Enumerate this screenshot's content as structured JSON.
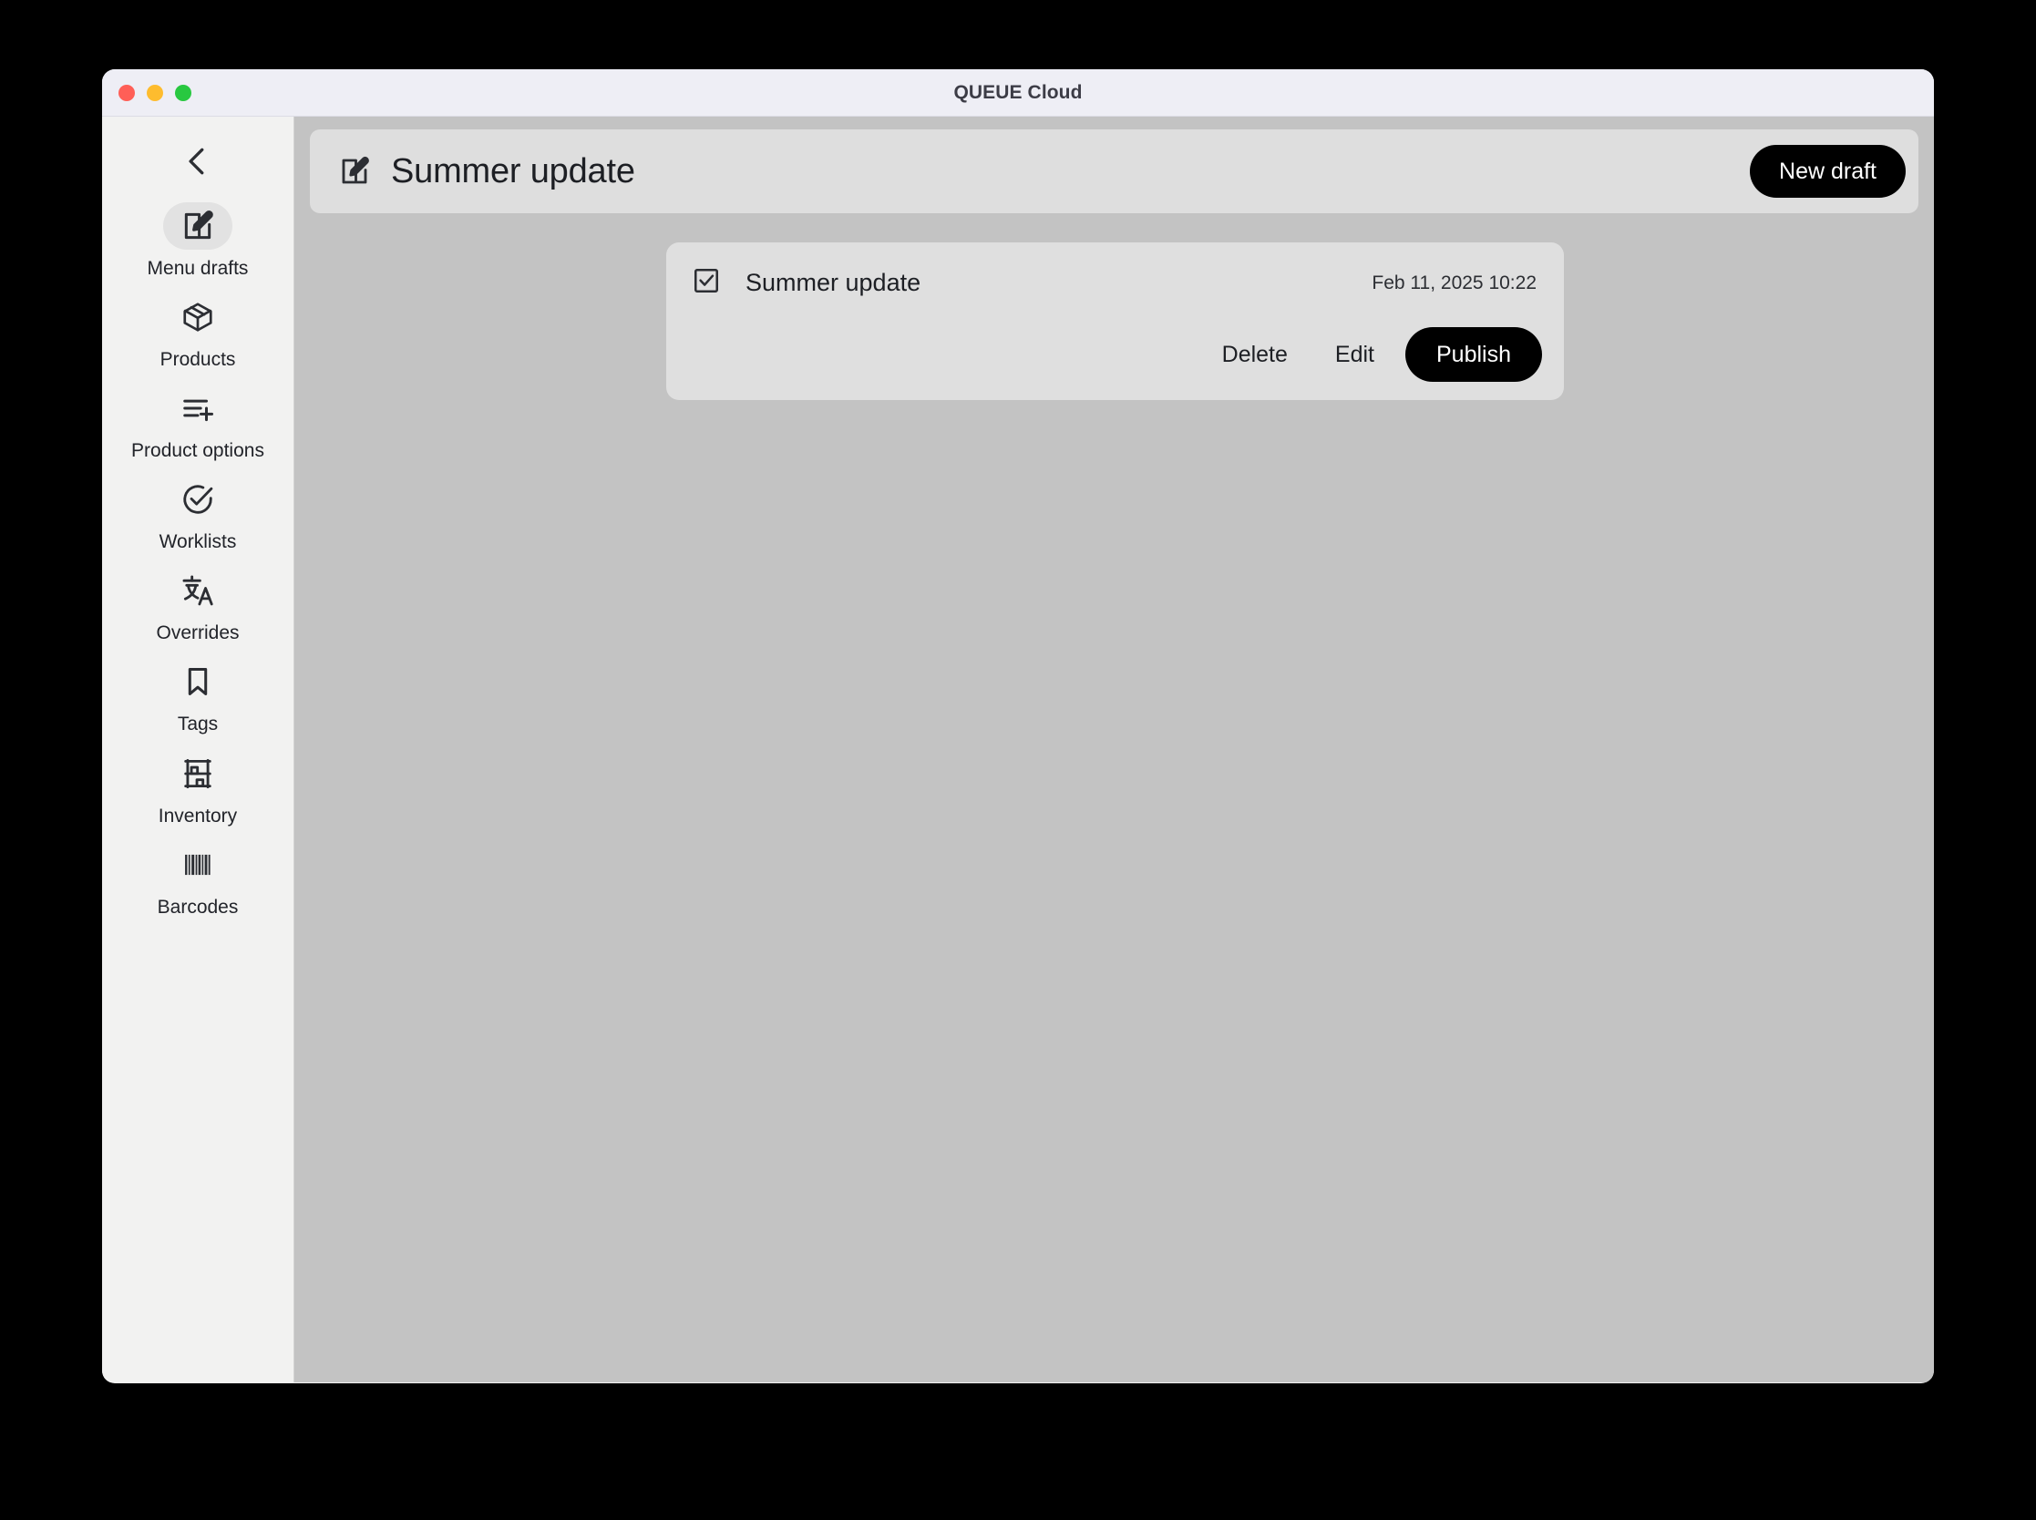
{
  "window": {
    "title": "QUEUE Cloud",
    "traffic_lights": [
      {
        "name": "close",
        "color": "#ff5f57"
      },
      {
        "name": "minimize",
        "color": "#febc2e"
      },
      {
        "name": "maximize",
        "color": "#28c840"
      }
    ]
  },
  "sidebar": {
    "back_icon": "chevron-left-icon",
    "items": [
      {
        "label": "Menu drafts",
        "icon": "edit-square-icon",
        "active": true
      },
      {
        "label": "Products",
        "icon": "box-icon",
        "active": false
      },
      {
        "label": "Product options",
        "icon": "list-plus-icon",
        "active": false
      },
      {
        "label": "Worklists",
        "icon": "check-circle-icon",
        "active": false
      },
      {
        "label": "Overrides",
        "icon": "translate-icon",
        "active": false
      },
      {
        "label": "Tags",
        "icon": "bookmark-icon",
        "active": false
      },
      {
        "label": "Inventory",
        "icon": "shelf-icon",
        "active": false
      },
      {
        "label": "Barcodes",
        "icon": "barcode-icon",
        "active": false
      }
    ]
  },
  "header": {
    "icon": "edit-square-icon",
    "title": "Summer update",
    "new_draft_label": "New draft"
  },
  "draft": {
    "checkbox_icon": "checkbox-checked-icon",
    "name": "Summer update",
    "date": "Feb 11, 2025 10:22",
    "actions": {
      "delete_label": "Delete",
      "edit_label": "Edit",
      "publish_label": "Publish"
    }
  },
  "colors": {
    "accent": "#000000",
    "titlebar_bg": "#eeeef5",
    "sidebar_bg": "#f2f2f1",
    "content_bg": "#c3c3c3",
    "card_bg": "#dfdfdf",
    "header_bg": "#dedede"
  }
}
